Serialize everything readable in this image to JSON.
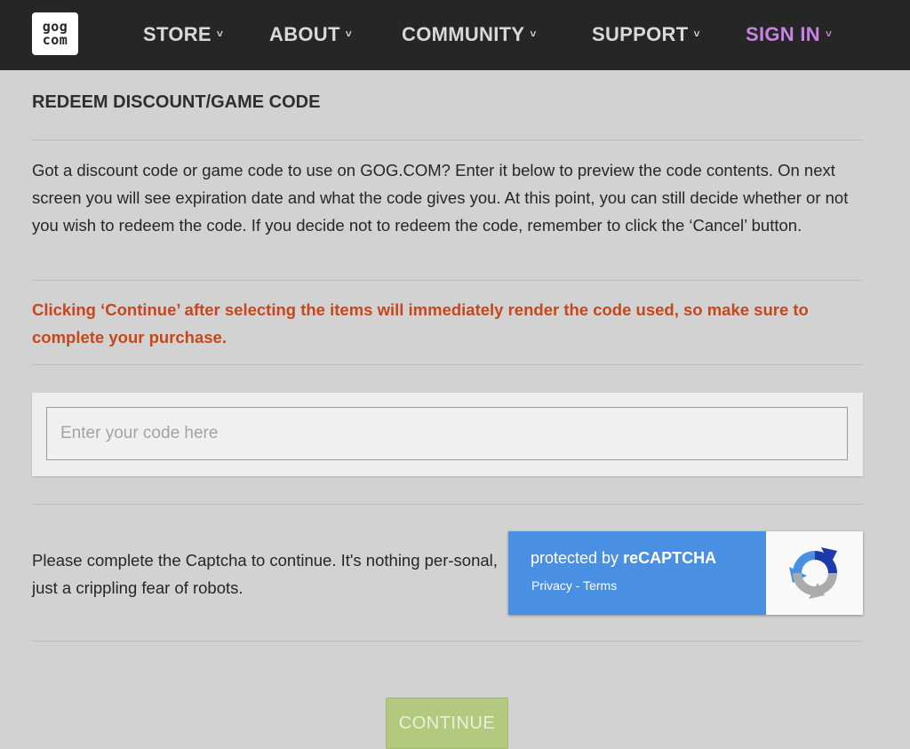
{
  "header": {
    "logo_top": "gog",
    "logo_bottom": "com",
    "nav": [
      {
        "label": "STORE"
      },
      {
        "label": "ABOUT"
      },
      {
        "label": "COMMUNITY"
      },
      {
        "label": "SUPPORT"
      },
      {
        "label": "SIGN IN"
      }
    ],
    "chevron": "˅",
    "signin_color": "#c983e3"
  },
  "page": {
    "title": "REDEEM DISCOUNT/GAME CODE",
    "description": "Got a discount code or game code to use on GOG.COM? Enter it below to preview the code contents. On next screen you will see expiration date and what the code gives you. At this point, you can still decide whether or not you wish to redeem the code. If you decide not to redeem the code, remember to click the ‘Cancel’ button.",
    "warning": "Clicking ‘Continue’ after selecting the items will immediately render the code used, so make sure to complete your purchase.",
    "warning_color": "#c7471d"
  },
  "code_input": {
    "placeholder": "Enter your code here",
    "value": ""
  },
  "captcha": {
    "text": "Please complete the Captcha to continue. It's nothing per-sonal, just a crippling fear of robots.",
    "badge_prefix": "protected by ",
    "badge_brand": "reCAPTCHA",
    "privacy": "Privacy",
    "separator": " - ",
    "terms": "Terms",
    "icon": "recaptcha-logo-icon"
  },
  "buttons": {
    "continue": "CONTINUE"
  }
}
